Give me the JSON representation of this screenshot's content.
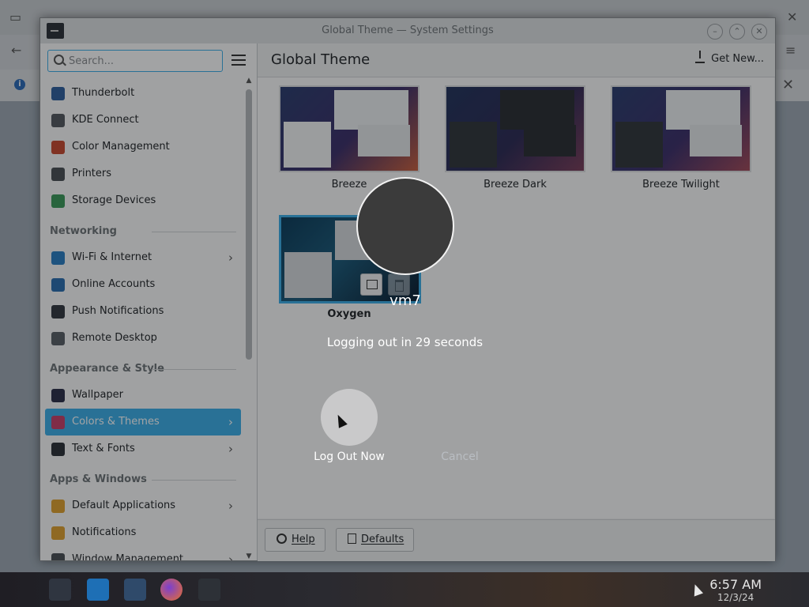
{
  "window": {
    "title": "Global Theme — System Settings",
    "controls": [
      "minimize",
      "maximize",
      "close"
    ]
  },
  "search": {
    "placeholder": "Search..."
  },
  "sidebar": {
    "items": [
      {
        "type": "item",
        "label": "Thunderbolt",
        "icon": "thunderbolt-icon",
        "color": "#2f5f9e",
        "chevron": false
      },
      {
        "type": "item",
        "label": "KDE Connect",
        "icon": "phone-icon",
        "color": "#555a60",
        "chevron": false
      },
      {
        "type": "item",
        "label": "Color Management",
        "icon": "color-wheel-icon",
        "color": "#c84a2f",
        "chevron": false
      },
      {
        "type": "item",
        "label": "Printers",
        "icon": "printer-icon",
        "color": "#4b4f55",
        "chevron": false
      },
      {
        "type": "item",
        "label": "Storage Devices",
        "icon": "storage-icon",
        "color": "#3b9a5a",
        "chevron": false
      },
      {
        "type": "header",
        "label": "Networking"
      },
      {
        "type": "item",
        "label": "Wi-Fi & Internet",
        "icon": "globe-icon",
        "color": "#2b7fc4",
        "chevron": true
      },
      {
        "type": "item",
        "label": "Online Accounts",
        "icon": "accounts-icon",
        "color": "#2b6fb0",
        "chevron": false
      },
      {
        "type": "item",
        "label": "Push Notifications",
        "icon": "pin-icon",
        "color": "#333840",
        "chevron": false
      },
      {
        "type": "item",
        "label": "Remote Desktop",
        "icon": "remote-desktop-icon",
        "color": "#5a5f66",
        "chevron": false
      },
      {
        "type": "header",
        "label": "Appearance & Style"
      },
      {
        "type": "item",
        "label": "Wallpaper",
        "icon": "wallpaper-icon",
        "color": "#2c2f4a",
        "chevron": false
      },
      {
        "type": "item",
        "label": "Colors & Themes",
        "icon": "palette-icon",
        "color": "#c9406a",
        "chevron": true,
        "active": true
      },
      {
        "type": "item",
        "label": "Text & Fonts",
        "icon": "fonts-icon",
        "color": "#2d3137",
        "chevron": true
      },
      {
        "type": "header",
        "label": "Apps & Windows"
      },
      {
        "type": "item",
        "label": "Default Applications",
        "icon": "star-icon",
        "color": "#e0a230",
        "chevron": true
      },
      {
        "type": "item",
        "label": "Notifications",
        "icon": "bell-icon",
        "color": "#e0a230",
        "chevron": false
      },
      {
        "type": "item",
        "label": "Window Management",
        "icon": "window-icon",
        "color": "#4b4f55",
        "chevron": true
      }
    ]
  },
  "main": {
    "title": "Global Theme",
    "get_new": "Get New..."
  },
  "themes": [
    {
      "name": "Breeze",
      "variant": "light"
    },
    {
      "name": "Breeze Dark",
      "variant": "dark"
    },
    {
      "name": "Breeze Twilight",
      "variant": "twilight"
    },
    {
      "name": "Oxygen",
      "variant": "oxygen",
      "selected": true
    }
  ],
  "footer": {
    "help": "Help",
    "defaults": "Defaults"
  },
  "logout": {
    "username": "vm7",
    "countdown": "Logging out in 29 seconds",
    "logout_now": "Log Out Now",
    "cancel": "Cancel"
  },
  "taskbar": {
    "time": "6:57 AM",
    "date": "12/3/24"
  },
  "colors": {
    "accent": "#3daee9",
    "window_bg": "#eff0f1"
  }
}
